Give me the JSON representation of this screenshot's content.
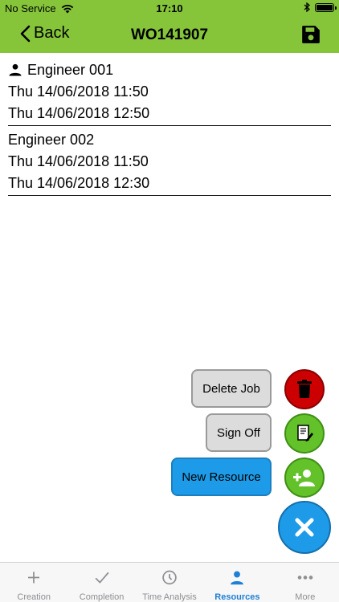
{
  "status": {
    "carrier": "No Service",
    "time": "17:10"
  },
  "nav": {
    "back_label": "Back",
    "title": "WO141907"
  },
  "engineers": [
    {
      "name": "Engineer 001",
      "start": "Thu 14/06/2018 11:50",
      "end": "Thu 14/06/2018 12:50"
    },
    {
      "name": "Engineer 002",
      "start": "Thu 14/06/2018 11:50",
      "end": "Thu 14/06/2018 12:30"
    }
  ],
  "actions": {
    "delete_label": "Delete Job",
    "signoff_label": "Sign Off",
    "new_resource_label": "New Resource"
  },
  "tabs": [
    {
      "label": "Creation",
      "icon": "plus-icon"
    },
    {
      "label": "Completion",
      "icon": "checkmark-icon"
    },
    {
      "label": "Time Analysis",
      "icon": "clock-icon"
    },
    {
      "label": "Resources",
      "icon": "person-icon",
      "active": true
    },
    {
      "label": "More",
      "icon": "more-dots-icon"
    }
  ],
  "colors": {
    "header": "#86c53a",
    "delete": "#cc0000",
    "green_action": "#63c12a",
    "blue_action": "#1e9be8",
    "tab_active": "#1e7fd6"
  }
}
